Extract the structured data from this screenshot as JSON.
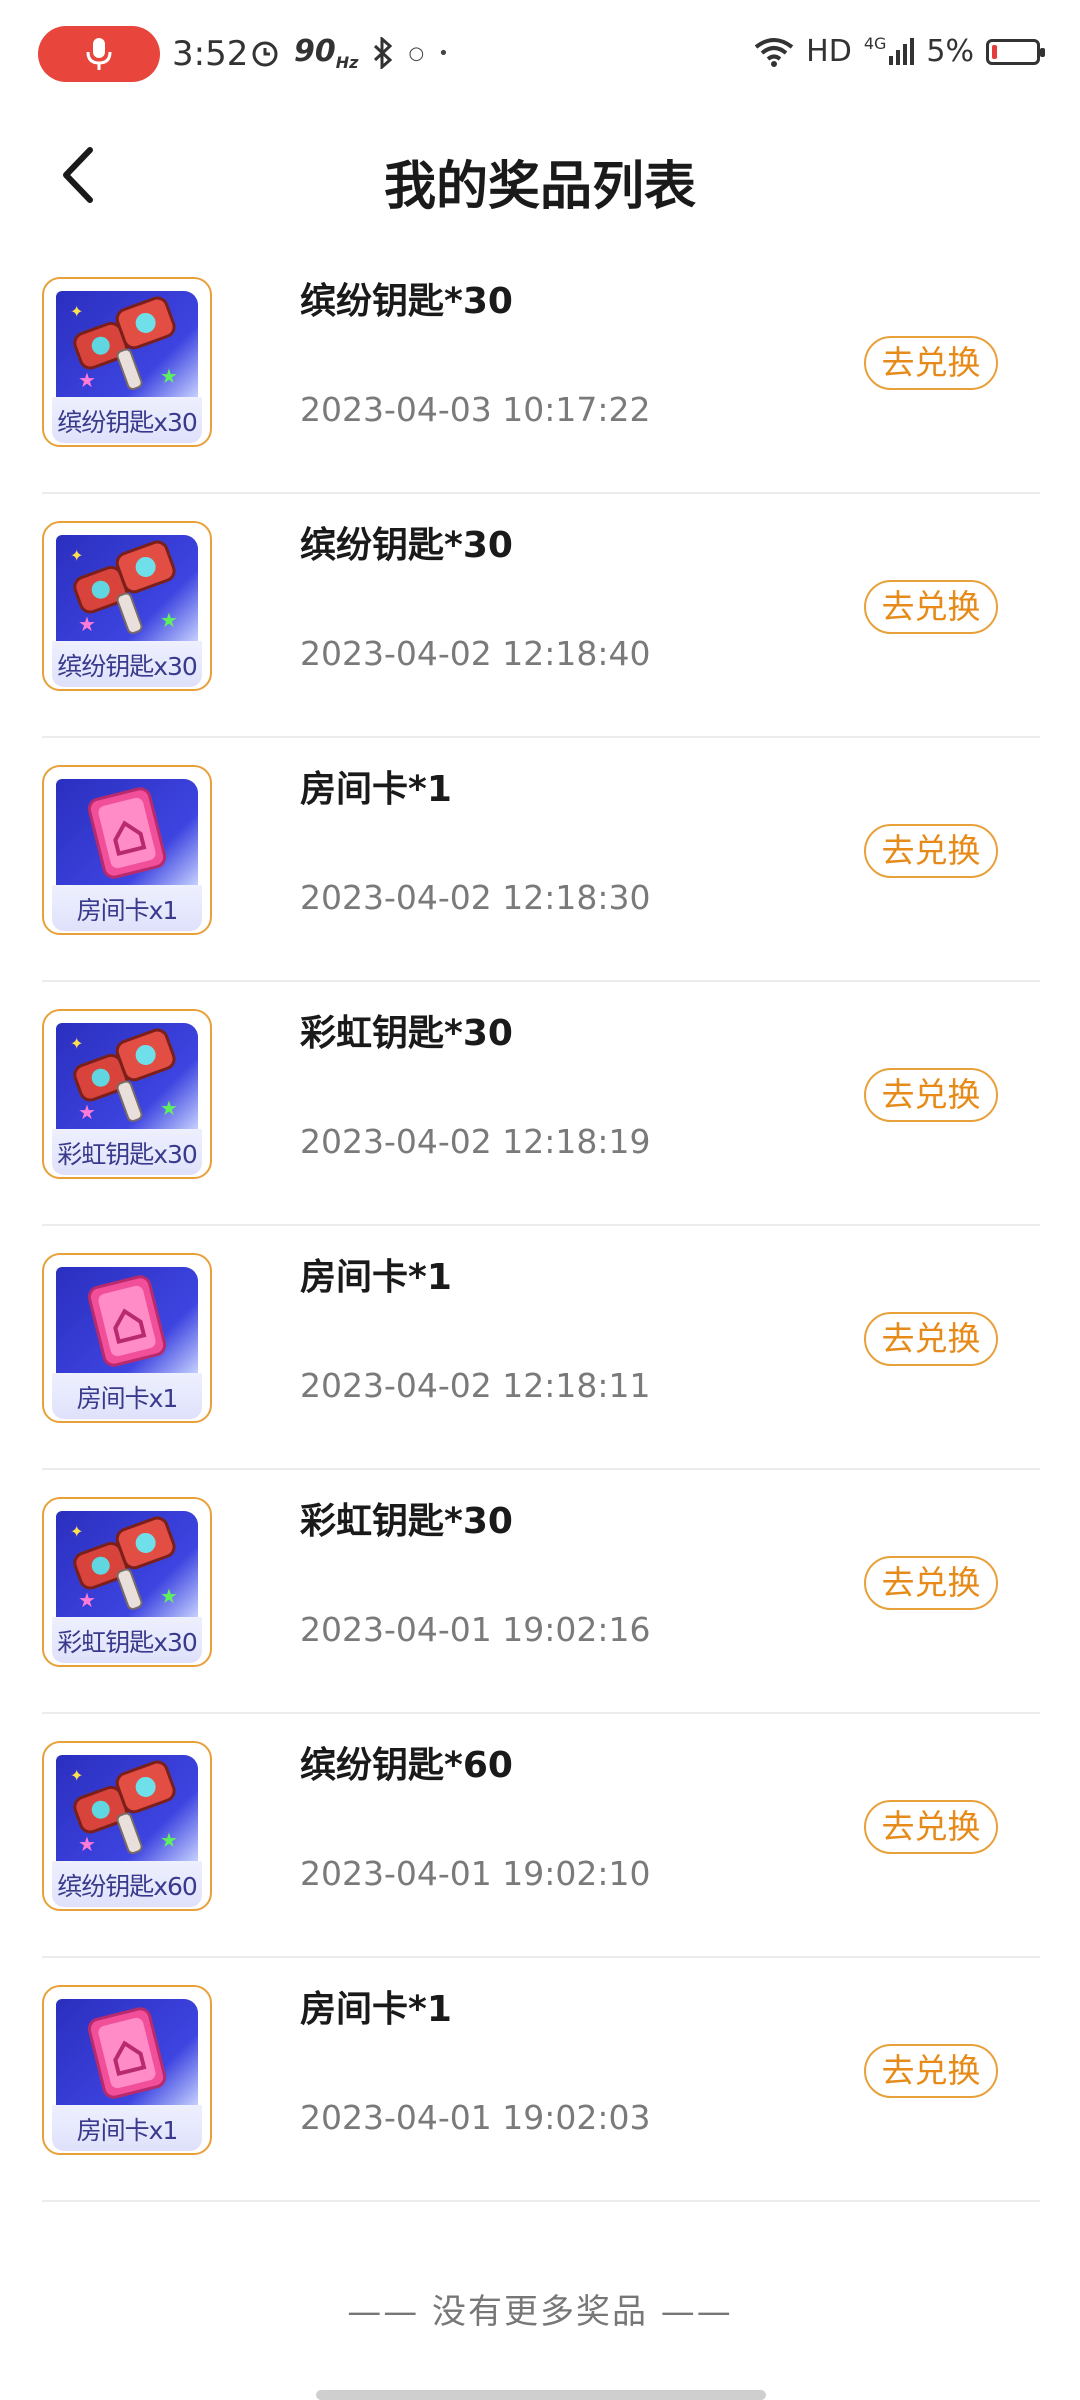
{
  "status_bar": {
    "time": "3:52",
    "refresh_rate": "90",
    "refresh_unit": "Hz",
    "network": "HD",
    "signal": "4G",
    "battery": "5%"
  },
  "header": {
    "title": "我的奖品列表"
  },
  "prizes": [
    {
      "name": "缤纷钥匙*30",
      "time": "2023-04-03 10:17:22",
      "thumb_label": "缤纷钥匙x30",
      "thumb_icon": "key-icon",
      "button": "去兑换"
    },
    {
      "name": "缤纷钥匙*30",
      "time": "2023-04-02 12:18:40",
      "thumb_label": "缤纷钥匙x30",
      "thumb_icon": "key-icon",
      "button": "去兑换"
    },
    {
      "name": "房间卡*1",
      "time": "2023-04-02 12:18:30",
      "thumb_label": "房间卡x1",
      "thumb_icon": "room-card-icon",
      "button": "去兑换"
    },
    {
      "name": "彩虹钥匙*30",
      "time": "2023-04-02 12:18:19",
      "thumb_label": "彩虹钥匙x30",
      "thumb_icon": "key-icon",
      "button": "去兑换"
    },
    {
      "name": "房间卡*1",
      "time": "2023-04-02 12:18:11",
      "thumb_label": "房间卡x1",
      "thumb_icon": "room-card-icon",
      "button": "去兑换"
    },
    {
      "name": "彩虹钥匙*30",
      "time": "2023-04-01 19:02:16",
      "thumb_label": "彩虹钥匙x30",
      "thumb_icon": "key-icon",
      "button": "去兑换"
    },
    {
      "name": "缤纷钥匙*60",
      "time": "2023-04-01 19:02:10",
      "thumb_label": "缤纷钥匙x60",
      "thumb_icon": "key-icon",
      "button": "去兑换"
    },
    {
      "name": "房间卡*1",
      "time": "2023-04-01 19:02:03",
      "thumb_label": "房间卡x1",
      "thumb_icon": "room-card-icon",
      "button": "去兑换"
    }
  ],
  "footer": {
    "no_more": "—— 没有更多奖品 ——"
  },
  "colors": {
    "accent": "#e8a13a",
    "accent_text": "#e68a1a",
    "thumb_bg": "#3d44e0"
  }
}
